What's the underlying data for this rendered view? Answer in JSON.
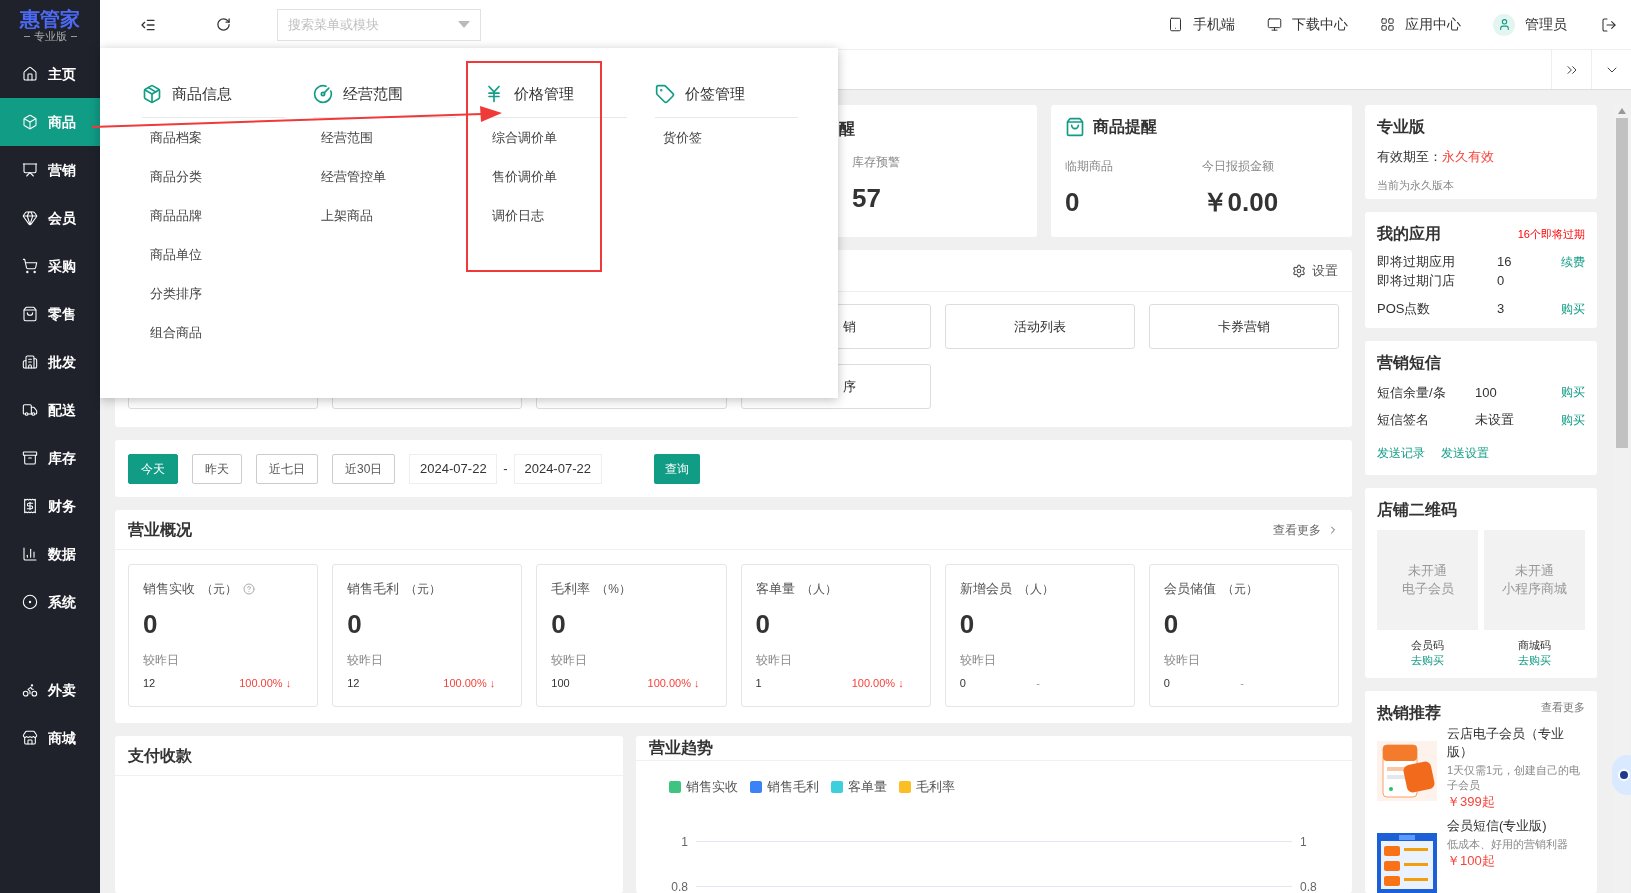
{
  "app": {
    "logo": "惠管家",
    "edition": "专业版"
  },
  "sidebar": {
    "items": [
      {
        "label": "主页",
        "selected": false
      },
      {
        "label": "商品",
        "selected": true
      },
      {
        "label": "营销",
        "selected": false
      },
      {
        "label": "会员",
        "selected": false
      },
      {
        "label": "采购",
        "selected": false
      },
      {
        "label": "零售",
        "selected": false
      },
      {
        "label": "批发",
        "selected": false
      },
      {
        "label": "配送",
        "selected": false
      },
      {
        "label": "库存",
        "selected": false
      },
      {
        "label": "财务",
        "selected": false
      },
      {
        "label": "数据",
        "selected": false
      },
      {
        "label": "系统",
        "selected": false
      }
    ],
    "extra_items": [
      {
        "label": "外卖",
        "selected": false
      },
      {
        "label": "商城",
        "selected": false
      }
    ]
  },
  "header": {
    "search": {
      "placeholder": "搜索菜单或模块"
    },
    "links": [
      "手机端",
      "下载中心",
      "应用中心"
    ],
    "user": "管理员"
  },
  "menu_panel": {
    "columns": [
      {
        "title": "商品信息",
        "highlighted": false,
        "items": [
          "商品档案",
          "商品分类",
          "商品品牌",
          "商品单位",
          "分类排序",
          "组合商品"
        ]
      },
      {
        "title": "经营范围",
        "highlighted": false,
        "items": [
          "经营范围",
          "经营管控单",
          "上架商品"
        ]
      },
      {
        "title": "价格管理",
        "highlighted": true,
        "items": [
          "综合调价单",
          "售价调价单",
          "调价日志"
        ]
      },
      {
        "title": "价签管理",
        "highlighted": false,
        "items": [
          "货价签"
        ]
      }
    ]
  },
  "stock_alert": {
    "title": "醒",
    "label": "库存预警",
    "value": "57"
  },
  "product_alert": {
    "title": "商品提醒",
    "metrics": [
      {
        "label": "临期商品",
        "value": "0"
      },
      {
        "label": "今日报损金额",
        "value": "￥0.00"
      }
    ]
  },
  "shortcuts": {
    "settings": "设置",
    "rows": [
      [
        {
          "label": "销",
          "kind": "partial"
        },
        {
          "label": "活动列表",
          "kind": "full"
        },
        {
          "label": "卡券营销",
          "kind": "full"
        }
      ],
      [
        {
          "label": "序",
          "kind": "partial"
        }
      ]
    ]
  },
  "filter": {
    "ranges": [
      {
        "label": "今天",
        "selected": true
      },
      {
        "label": "昨天",
        "selected": false
      },
      {
        "label": "近七日",
        "selected": false
      },
      {
        "label": "近30日",
        "selected": false
      }
    ],
    "date_from": "2024-07-22",
    "separator": "-",
    "date_to": "2024-07-22",
    "query": "查询"
  },
  "overview": {
    "title": "营业概况",
    "more": "查看更多",
    "cards": [
      {
        "label": "销售实收",
        "unit": "（元）",
        "help": true,
        "value": "0",
        "compare": "较昨日",
        "previous": "12",
        "change": "100.00% ↓",
        "kind": "down"
      },
      {
        "label": "销售毛利",
        "unit": "（元）",
        "help": false,
        "value": "0",
        "compare": "较昨日",
        "previous": "12",
        "change": "100.00% ↓",
        "kind": "down"
      },
      {
        "label": "毛利率",
        "unit": "（%）",
        "help": false,
        "value": "0",
        "compare": "较昨日",
        "previous": "100",
        "change": "100.00% ↓",
        "kind": "down"
      },
      {
        "label": "客单量",
        "unit": "（人）",
        "help": false,
        "value": "0",
        "compare": "较昨日",
        "previous": "1",
        "change": "100.00% ↓",
        "kind": "down"
      },
      {
        "label": "新增会员",
        "unit": "（人）",
        "help": false,
        "value": "0",
        "compare": "较昨日",
        "previous": "0",
        "change": "-",
        "kind": "flat"
      },
      {
        "label": "会员储值",
        "unit": "（元）",
        "help": false,
        "value": "0",
        "compare": "较昨日",
        "previous": "0",
        "change": "-",
        "kind": "flat"
      }
    ]
  },
  "payments": {
    "title": "支付收款"
  },
  "trend": {
    "title": "营业趋势",
    "chart_data": {
      "type": "line",
      "series": [
        {
          "name": "销售实收",
          "color": "#3cc480"
        },
        {
          "name": "销售毛利",
          "color": "#3b82f6"
        },
        {
          "name": "客单量",
          "color": "#3ecfdc"
        },
        {
          "name": "毛利率",
          "color": "#fbbf24"
        }
      ],
      "ylim": [
        0.8,
        1
      ],
      "yticks": [
        0.8,
        1
      ],
      "y2lim": [
        0.8,
        1
      ],
      "y2ticks": [
        0.8,
        1
      ]
    }
  },
  "edition": {
    "title": "专业版",
    "expiry_label": "有效期至：",
    "expiry_value": "永久有效",
    "note": "当前为永久版本"
  },
  "my_apps": {
    "title": "我的应用",
    "alert": "16个即将过期",
    "rows": [
      {
        "label": "即将过期应用",
        "value": "16",
        "action": "续费"
      },
      {
        "label": "即将过期门店",
        "value": "0"
      },
      {
        "label": "POS点数",
        "value": "3",
        "action": "购买"
      }
    ]
  },
  "sms": {
    "title": "营销短信",
    "rows": [
      {
        "label": "短信余量/条",
        "value": "100",
        "action": "购买"
      },
      {
        "label": "短信签名",
        "value": "未设置",
        "action": "购买"
      }
    ],
    "links": [
      "发送记录",
      "发送设置"
    ]
  },
  "qr_codes": {
    "title": "店铺二维码",
    "codes": [
      {
        "status": "未开通",
        "name": "电子会员",
        "label": "会员码",
        "action": "去购买"
      },
      {
        "status": "未开通",
        "name": "小程序商城",
        "label": "商城码",
        "action": "去购买"
      }
    ]
  },
  "hot": {
    "title": "热销推荐",
    "more": "查看更多",
    "items": [
      {
        "name": "云店电子会员（专业版）",
        "desc": "1天仅需1元，创建自己的电子会员",
        "price": "￥399起"
      },
      {
        "name": "会员短信(专业版)",
        "desc": "低成本、好用的营销利器",
        "price": "￥100起"
      }
    ]
  }
}
